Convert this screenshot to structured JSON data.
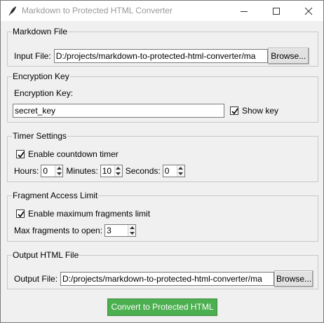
{
  "window": {
    "title": "Markdown to Protected HTML Converter"
  },
  "markdown_file": {
    "legend": "Markdown File",
    "input_label": "Input File:",
    "input_value": "D:/projects/markdown-to-protected-html-converter/ma",
    "browse_label": "Browse..."
  },
  "encryption": {
    "legend": "Encryption Key",
    "key_label": "Encryption Key:",
    "key_value": "secret_key",
    "show_key_label": "Show key",
    "show_key_checked": true
  },
  "timer": {
    "legend": "Timer Settings",
    "enable_label": "Enable countdown timer",
    "enable_checked": true,
    "hours_label": "Hours:",
    "hours_value": "0",
    "minutes_label": "Minutes:",
    "minutes_value": "10",
    "seconds_label": "Seconds:",
    "seconds_value": "0"
  },
  "fragments": {
    "legend": "Fragment Access Limit",
    "enable_label": "Enable maximum fragments limit",
    "enable_checked": true,
    "max_label": "Max fragments to open:",
    "max_value": "3"
  },
  "output": {
    "legend": "Output HTML File",
    "output_label": "Output File:",
    "output_value": "D:/projects/markdown-to-protected-html-converter/ma",
    "browse_label": "Browse..."
  },
  "convert_label": "Convert to Protected HTML",
  "colors": {
    "convert_button": "#4caf50",
    "title_text": "#999999"
  }
}
